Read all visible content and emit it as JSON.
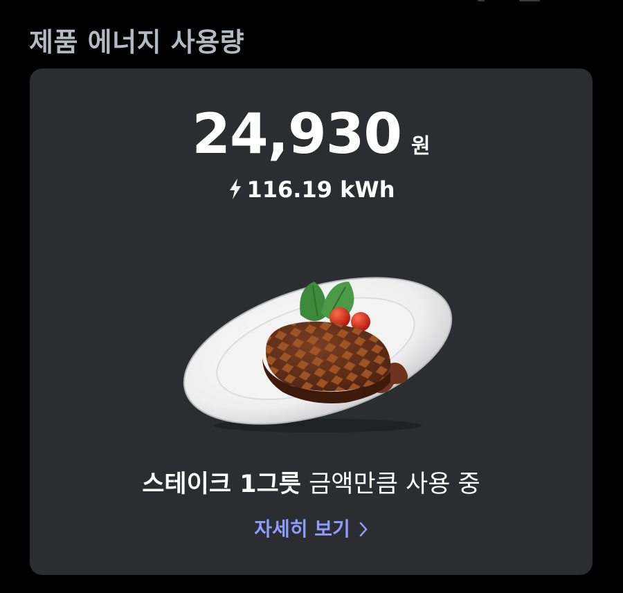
{
  "section": {
    "title": "제품 에너지 사용량"
  },
  "usage": {
    "cost_amount": "24,930",
    "cost_unit": "원",
    "energy_value": "116.19 kWh",
    "icon": "lightning-bolt-icon"
  },
  "comparison": {
    "item_label": "스테이크 1그릇",
    "suffix": " 금액만큼 사용 중",
    "illustration": "steak-plate-illustration"
  },
  "detail_link": {
    "label": "자세히 보기",
    "icon": "chevron-right-icon",
    "color": "#8f9cff"
  },
  "colors": {
    "background": "#000000",
    "card": "#2b2d31",
    "title": "#b3bac4"
  }
}
